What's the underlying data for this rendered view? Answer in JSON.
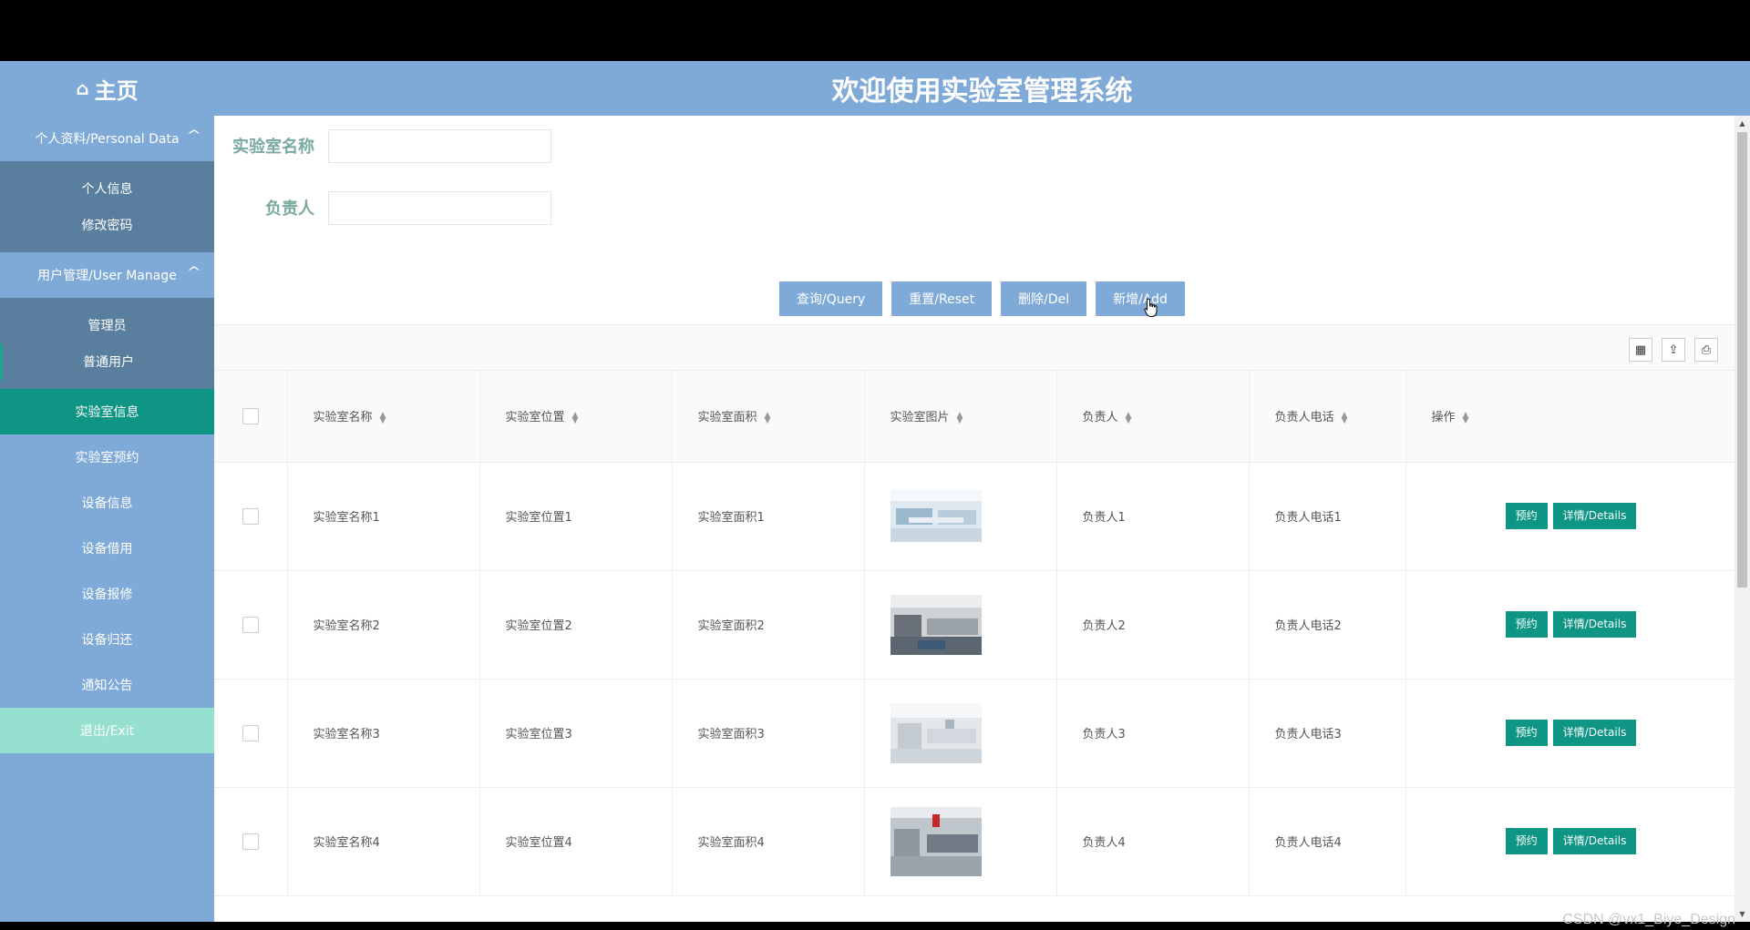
{
  "header": {
    "home_icon": "home-icon",
    "home_label": "主页",
    "site_title": "欢迎使用实验室管理系统"
  },
  "sidebar": {
    "group_personal": "个人资料/Personal Data",
    "personal_items": [
      "个人信息",
      "修改密码"
    ],
    "group_user": "用户管理/User Manage",
    "user_items": [
      "管理员",
      "普通用户"
    ],
    "items": [
      "实验室信息",
      "实验室预约",
      "设备信息",
      "设备借用",
      "设备报修",
      "设备归还",
      "通知公告"
    ],
    "exit_label": "退出/Exit",
    "active_item": "实验室信息"
  },
  "search": {
    "name_label": "实验室名称",
    "name_value": "",
    "person_label": "负责人",
    "person_value": ""
  },
  "actions": {
    "query": "查询/Query",
    "reset": "重置/Reset",
    "delete": "删除/Del",
    "add": "新增/Add"
  },
  "toolbar_icons": [
    "columns-icon",
    "export-icon",
    "print-icon"
  ],
  "table": {
    "columns": [
      "实验室名称",
      "实验室位置",
      "实验室面积",
      "实验室图片",
      "负责人",
      "负责人电话",
      "操作"
    ],
    "rows": [
      {
        "name": "实验室名称1",
        "location": "实验室位置1",
        "area": "实验室面积1",
        "person": "负责人1",
        "phone": "负责人电话1"
      },
      {
        "name": "实验室名称2",
        "location": "实验室位置2",
        "area": "实验室面积2",
        "person": "负责人2",
        "phone": "负责人电话2"
      },
      {
        "name": "实验室名称3",
        "location": "实验室位置3",
        "area": "实验室面积3",
        "person": "负责人3",
        "phone": "负责人电话3"
      },
      {
        "name": "实验室名称4",
        "location": "实验室位置4",
        "area": "实验室面积4",
        "person": "负责人4",
        "phone": "负责人电话4"
      }
    ],
    "reserve_label": "预约",
    "details_label": "详情/Details"
  },
  "colors": {
    "theme": "#7faad8",
    "accent": "#0f9584",
    "submenu": "#5a7f9e",
    "exit": "#96e0cf",
    "label": "#7aa9a0"
  },
  "watermark": "CSDN @vx1_Biye_Design"
}
